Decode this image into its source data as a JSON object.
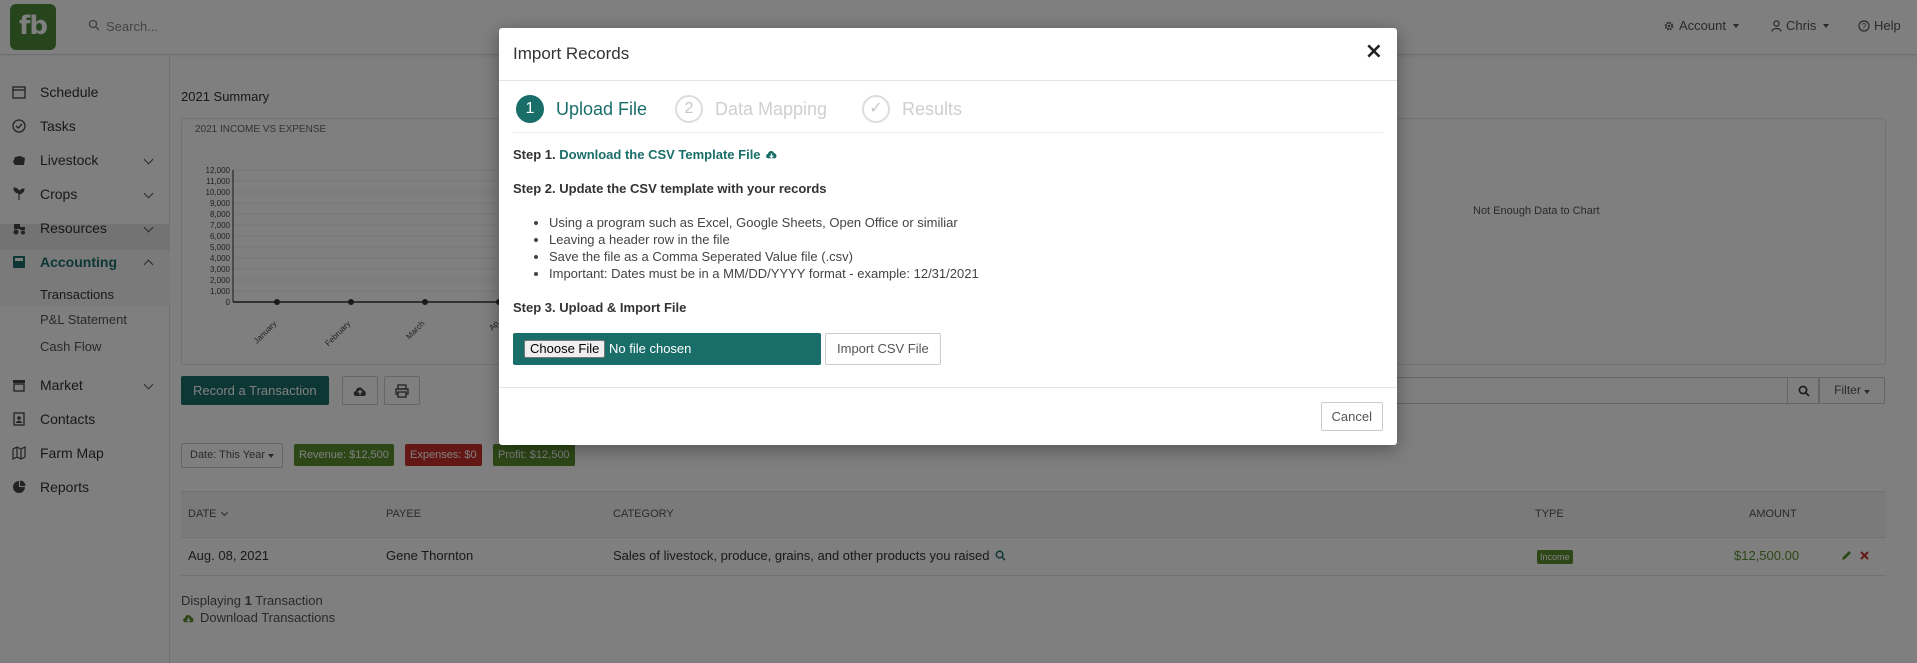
{
  "app": {
    "logo_text": "fb"
  },
  "header": {
    "search_placeholder": "Search...",
    "account_label": "Account",
    "user_label": "Chris",
    "help_label": "Help"
  },
  "sidebar": {
    "items": [
      {
        "label": "Schedule",
        "icon": "calendar-icon"
      },
      {
        "label": "Tasks",
        "icon": "check-circle-icon"
      },
      {
        "label": "Livestock",
        "icon": "cow-icon"
      },
      {
        "label": "Crops",
        "icon": "sprout-icon"
      },
      {
        "label": "Resources",
        "icon": "tractor-icon"
      },
      {
        "label": "Accounting",
        "icon": "calculator-icon"
      },
      {
        "label": "Market",
        "icon": "store-icon"
      },
      {
        "label": "Contacts",
        "icon": "address-book-icon"
      },
      {
        "label": "Farm Map",
        "icon": "map-icon"
      },
      {
        "label": "Reports",
        "icon": "pie-chart-icon"
      }
    ],
    "accounting_sub": [
      "Transactions",
      "P&L Statement",
      "Cash Flow"
    ]
  },
  "main": {
    "summary_title": "2021 Summary",
    "chart_title": "2021 INCOME VS EXPENSE",
    "no_data": "Not Enough Data to Chart",
    "record_button": "Record a Transaction",
    "filter_label": "Filter",
    "date_filter": "Date: This Year",
    "revenue_chip": "Revenue: $12,500",
    "expenses_chip": "Expenses: $0",
    "profit_chip": "Profit: $12,500",
    "table": {
      "headers": [
        "DATE",
        "PAYEE",
        "CATEGORY",
        "TYPE",
        "AMOUNT"
      ],
      "rows": [
        {
          "date": "Aug. 08, 2021",
          "payee": "Gene Thornton",
          "category": "Sales of livestock, produce, grains, and other products you raised",
          "type": "Income",
          "amount": "$12,500.00"
        }
      ]
    },
    "display_prefix": "Displaying",
    "display_count": "1",
    "display_suffix": "Transaction",
    "download_label": "Download Transactions"
  },
  "chart_data": {
    "type": "line",
    "title": "2021 INCOME VS EXPENSE",
    "categories": [
      "January",
      "February",
      "March",
      "Ap"
    ],
    "series": [
      {
        "values": [
          0,
          0,
          0,
          0
        ]
      }
    ],
    "ylim": [
      0,
      12000
    ],
    "yticks": [
      "12,000",
      "11,000",
      "10,000",
      "9,000",
      "8,000",
      "7,000",
      "6,000",
      "5,000",
      "4,000",
      "3,000",
      "2,000",
      "1,000",
      "0"
    ]
  },
  "modal": {
    "title": "Import Records",
    "close_glyph": "×",
    "steps": [
      {
        "num": "1",
        "label": "Upload File"
      },
      {
        "num": "2",
        "label": "Data Mapping"
      },
      {
        "num": "✓",
        "label": "Results"
      }
    ],
    "step1_prefix": "Step 1.",
    "step1_link": "Download the CSV Template File",
    "step2": "Step 2. Update the CSV template with your records",
    "bullets": [
      "Using a program such as Excel, Google Sheets, Open Office or similiar",
      "Leaving a header row in the file",
      "Save the file as a Comma Seperated Value file (.csv)",
      "Important: Dates must be in a MM/DD/YYYY format - example: 12/31/2021"
    ],
    "step3": "Step 3. Upload & Import File",
    "choose_file": "Choose File",
    "no_file": "No file chosen",
    "import_button": "Import CSV File",
    "cancel_button": "Cancel"
  },
  "colors": {
    "brand": "#1a6e6a",
    "logo": "#4e8a3a",
    "income": "#5a8f2e",
    "expense": "#c9302c"
  }
}
